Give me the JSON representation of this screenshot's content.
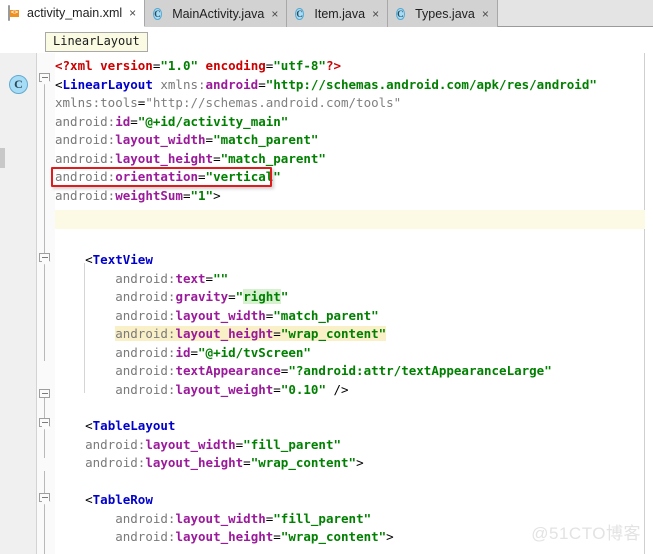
{
  "window": {
    "app": "Android Studio Editor",
    "watermark": "@51CTO博客"
  },
  "tabs": [
    {
      "label": "activity_main.xml",
      "icon": "xml-file-icon",
      "close": "×",
      "active": true
    },
    {
      "label": "MainActivity.java",
      "icon": "java-class-icon",
      "close": "×",
      "active": false
    },
    {
      "label": "Item.java",
      "icon": "java-class-icon",
      "close": "×",
      "active": false
    },
    {
      "label": "Types.java",
      "icon": "java-class-icon",
      "close": "×",
      "active": false
    }
  ],
  "breadcrumb": {
    "label": "LinearLayout"
  },
  "gutter": {
    "class_marker": "C"
  },
  "editor": {
    "language": "xml",
    "caret_line_index": 8,
    "highlight_box_text": "android:orientation=\"vertical\"",
    "lines": [
      {
        "n": 1,
        "indent": 0,
        "text": "<?xml version=\"1.0\" encoding=\"utf-8\"?>"
      },
      {
        "n": 2,
        "indent": 0,
        "text": "<LinearLayout xmlns:android=\"http://schemas.android.com/apk/res/android\""
      },
      {
        "n": 3,
        "indent": 0,
        "text": "xmlns:tools=\"http://schemas.android.com/tools\""
      },
      {
        "n": 4,
        "indent": 0,
        "text": "android:id=\"@+id/activity_main\""
      },
      {
        "n": 5,
        "indent": 0,
        "text": "android:layout_width=\"match_parent\""
      },
      {
        "n": 6,
        "indent": 0,
        "text": "android:layout_height=\"match_parent\""
      },
      {
        "n": 7,
        "indent": 0,
        "text": "android:orientation=\"vertical\""
      },
      {
        "n": 8,
        "indent": 0,
        "text": "android:weightSum=\"1\">"
      },
      {
        "n": 9,
        "indent": 0,
        "text": ""
      },
      {
        "n": 10,
        "indent": 0,
        "text": ""
      },
      {
        "n": 11,
        "indent": 1,
        "text": "<TextView"
      },
      {
        "n": 12,
        "indent": 2,
        "text": "android:text=\"\""
      },
      {
        "n": 13,
        "indent": 2,
        "text": "android:gravity=\"right\""
      },
      {
        "n": 14,
        "indent": 2,
        "text": "android:layout_width=\"match_parent\""
      },
      {
        "n": 15,
        "indent": 2,
        "text": "android:layout_height=\"wrap_content\""
      },
      {
        "n": 16,
        "indent": 2,
        "text": "android:id=\"@+id/tvScreen\""
      },
      {
        "n": 17,
        "indent": 2,
        "text": "android:textAppearance=\"?android:attr/textAppearanceLarge\""
      },
      {
        "n": 18,
        "indent": 2,
        "text": "android:layout_weight=\"0.10\" />"
      },
      {
        "n": 19,
        "indent": 0,
        "text": ""
      },
      {
        "n": 20,
        "indent": 1,
        "text": "<TableLayout"
      },
      {
        "n": 21,
        "indent": 1,
        "text": "android:layout_width=\"fill_parent\""
      },
      {
        "n": 22,
        "indent": 1,
        "text": "android:layout_height=\"wrap_content\">"
      },
      {
        "n": 23,
        "indent": 0,
        "text": ""
      },
      {
        "n": 24,
        "indent": 1,
        "text": "<TableRow"
      },
      {
        "n": 25,
        "indent": 2,
        "text": "android:layout_width=\"fill_parent\""
      },
      {
        "n": 26,
        "indent": 2,
        "text": "android:layout_height=\"wrap_content\">"
      }
    ],
    "inline_highlights": [
      {
        "line": 13,
        "token": "right",
        "color": "#d6f0d0"
      },
      {
        "line": 15,
        "token": "android:layout_height=\"wrap_content\"",
        "color": "#faf0c8"
      }
    ]
  },
  "colors": {
    "tag": "#0000cc",
    "attribute": "#9b1a9b",
    "value": "#008000",
    "namespace": "#7a7a7a",
    "processing_instruction": "#0000cc",
    "error_box": "#e01b1b",
    "caret_line": "#fcfae4",
    "tabbar_bg": "#d6d6d6",
    "gutter_bg": "#f0f0f0"
  }
}
